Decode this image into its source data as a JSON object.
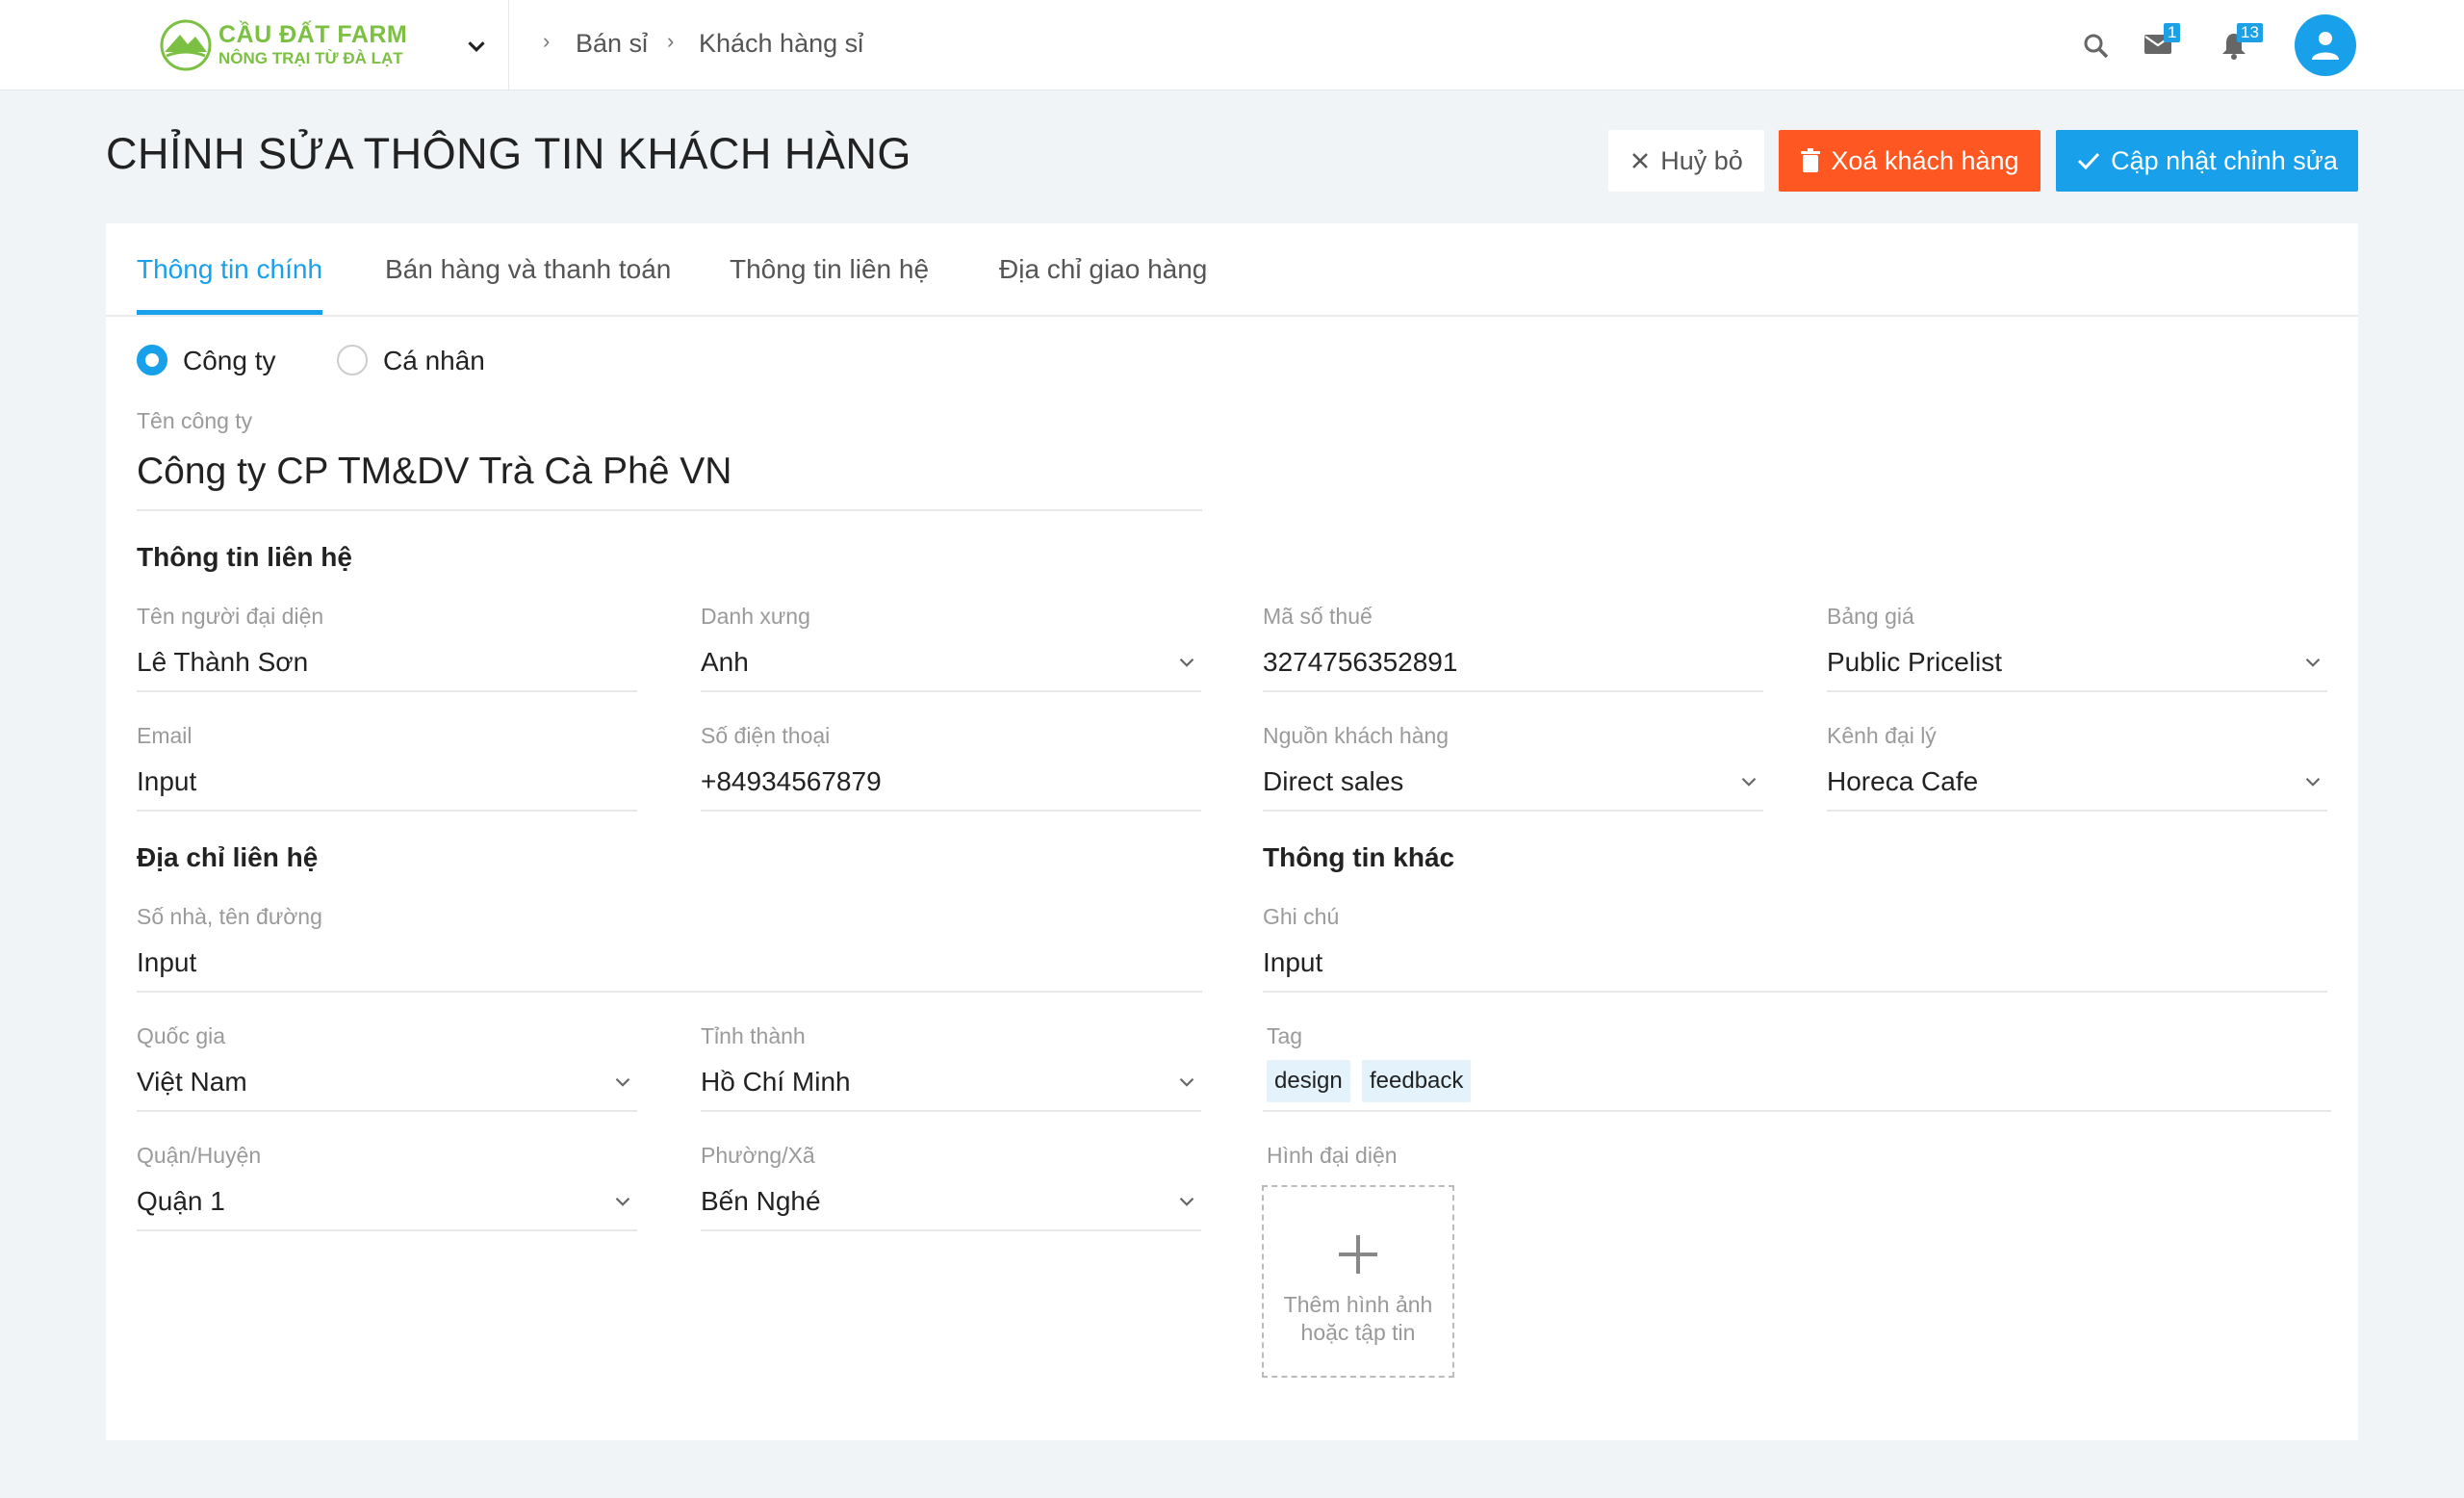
{
  "brand": {
    "name": "CẦU ĐẤT FARM",
    "tagline": "NÔNG TRẠI TỪ ĐÀ LẠT",
    "color": "#7cc043"
  },
  "breadcrumb": [
    "Bán sỉ",
    "Khách hàng sỉ"
  ],
  "header": {
    "icons": [
      "search-icon",
      "mail-icon",
      "bell-icon",
      "user-avatar-icon"
    ],
    "mail_count": "1",
    "notification_count": "13"
  },
  "page": {
    "title": "CHỈNH SỬA THÔNG TIN KHÁCH HÀNG"
  },
  "actions": {
    "cancel": "Huỷ bỏ",
    "delete": "Xoá khách hàng",
    "update": "Cập nhật chỉnh sửa"
  },
  "colors": {
    "primary": "#18a0ea",
    "danger": "#ff5722",
    "background": "#f0f4f6"
  },
  "tabs": [
    {
      "label": "Thông tin chính",
      "active": true
    },
    {
      "label": "Bán hàng và thanh toán",
      "active": false
    },
    {
      "label": "Thông tin liên hệ",
      "active": false
    },
    {
      "label": "Địa chỉ giao hàng",
      "active": false
    }
  ],
  "customer_type": {
    "options": [
      "Công ty",
      "Cá nhân"
    ],
    "selected": "Công ty"
  },
  "company": {
    "label": "Tên công ty",
    "value": "Công ty CP TM&DV Trà Cà Phê VN"
  },
  "contact_section": {
    "title": "Thông tin liên hệ",
    "representative": {
      "label": "Tên người đại diện",
      "value": "Lê Thành Sơn"
    },
    "salutation": {
      "label": "Danh xưng",
      "value": "Anh"
    },
    "tax_code": {
      "label": "Mã số thuế",
      "value": "3274756352891"
    },
    "pricelist": {
      "label": "Bảng giá",
      "value": "Public Pricelist"
    },
    "email": {
      "label": "Email",
      "value": "Input"
    },
    "phone": {
      "label": "Số điện thoại",
      "value": "+84934567879"
    },
    "source": {
      "label": "Nguồn khách hàng",
      "value": "Direct sales"
    },
    "channel": {
      "label": "Kênh đại lý",
      "value": "Horeca Cafe"
    }
  },
  "address_section": {
    "title": "Địa chỉ liên hệ",
    "street": {
      "label": "Số nhà, tên đường",
      "value": "Input"
    },
    "country": {
      "label": "Quốc gia",
      "value": "Việt Nam"
    },
    "province": {
      "label": "Tỉnh thành",
      "value": "Hồ Chí Minh"
    },
    "district": {
      "label": "Quận/Huyện",
      "value": "Quận 1"
    },
    "ward": {
      "label": "Phường/Xã",
      "value": "Bến Nghé"
    }
  },
  "other_section": {
    "title": "Thông tin khác",
    "note": {
      "label": "Ghi chú",
      "value": "Input"
    },
    "tag_label": "Tag",
    "tags": [
      "design",
      "feedback"
    ],
    "avatar_label": "Hình đại diện",
    "upload_text": "Thêm hình ảnh hoặc tập tin"
  }
}
